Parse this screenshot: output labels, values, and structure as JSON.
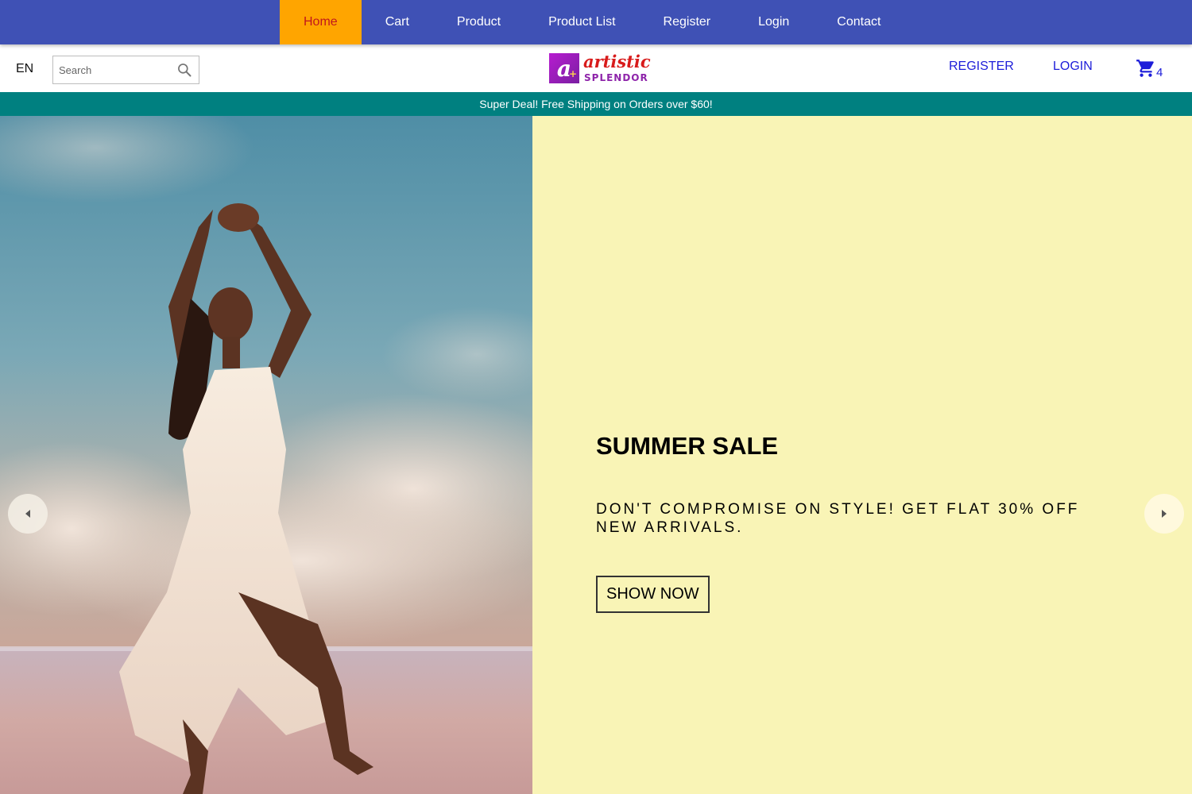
{
  "nav": {
    "items": [
      {
        "label": "Home",
        "active": true
      },
      {
        "label": "Cart"
      },
      {
        "label": "Product"
      },
      {
        "label": "Product List"
      },
      {
        "label": "Register"
      },
      {
        "label": "Login"
      },
      {
        "label": "Contact"
      }
    ]
  },
  "header": {
    "language": "EN",
    "search": {
      "placeholder": "Search",
      "value": ""
    },
    "logo": {
      "line1": "artistic",
      "line2": "SPLENDOR"
    },
    "register_label": "REGISTER",
    "login_label": "LOGIN",
    "cart_count": "4"
  },
  "announcement": "Super Deal! Free Shipping on Orders over $60!",
  "hero": {
    "title": "SUMMER SALE",
    "description": "DON'T COMPROMISE ON STYLE! GET FLAT 30% OFF NEW ARRIVALS.",
    "button_label": "SHOW NOW",
    "background_color": "#f9f4b6"
  },
  "colors": {
    "nav_bg": "#3f51b5",
    "nav_active_bg": "#ffa500",
    "nav_active_text": "#c0171d",
    "link_blue": "#1d1dd9",
    "announce_bg": "#008080"
  },
  "icons": {
    "search": "search-icon",
    "cart": "cart-icon",
    "prev": "arrow-left-icon",
    "next": "arrow-right-icon"
  }
}
